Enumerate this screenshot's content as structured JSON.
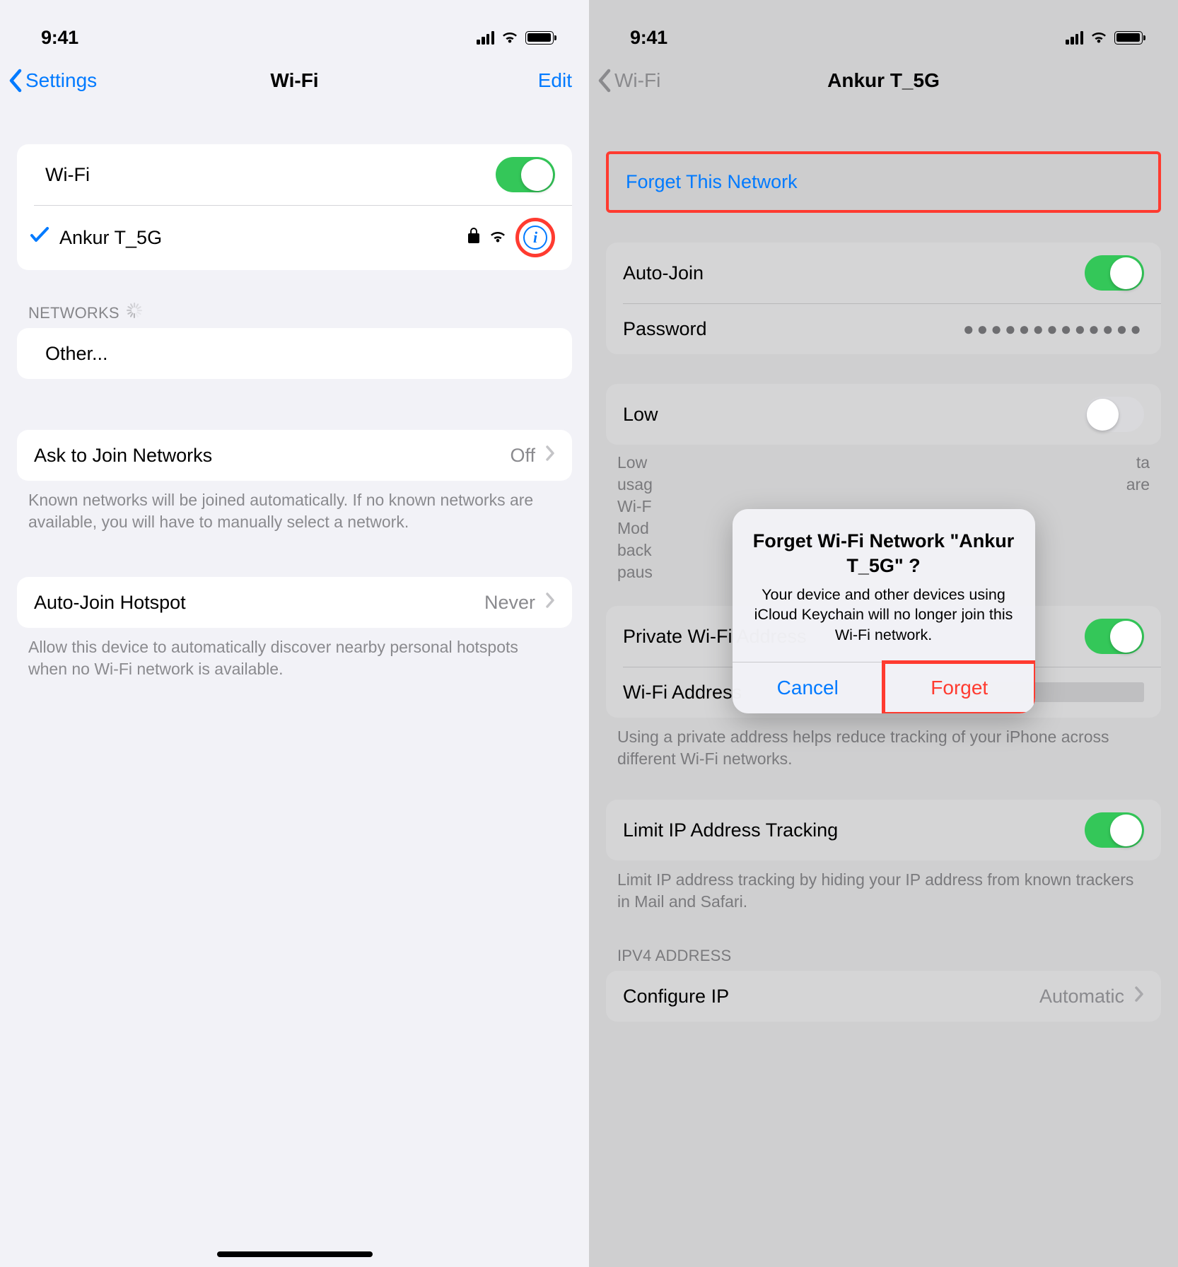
{
  "statusbar": {
    "time": "9:41"
  },
  "left": {
    "nav": {
      "back": "Settings",
      "title": "Wi-Fi",
      "edit": "Edit"
    },
    "wifi_row_label": "Wi-Fi",
    "connected_network": "Ankur T_5G",
    "networks_header": "NETWORKS",
    "other_label": "Other...",
    "ask_join": {
      "label": "Ask to Join Networks",
      "value": "Off"
    },
    "ask_join_footer": "Known networks will be joined automatically. If no known networks are available, you will have to manually select a network.",
    "auto_hotspot": {
      "label": "Auto-Join Hotspot",
      "value": "Never"
    },
    "auto_hotspot_footer": "Allow this device to automatically discover nearby personal hotspots when no Wi-Fi network is available."
  },
  "right": {
    "nav": {
      "back": "Wi-Fi",
      "title": "Ankur T_5G"
    },
    "forget_label": "Forget This Network",
    "auto_join_label": "Auto-Join",
    "password_label": "Password",
    "password_mask": "●●●●●●●●●●●●●",
    "low_data_label": "Low",
    "low_data_footer_lines": [
      "Low",
      "usag",
      "Wi-F",
      "Mod",
      "back",
      "paus"
    ],
    "low_data_footer_right": [
      "ta",
      "",
      "",
      "",
      "are",
      ""
    ],
    "private_addr_label": "Private Wi-Fi Address",
    "wifi_addr_label": "Wi-Fi Address",
    "private_footer": "Using a private address helps reduce tracking of your iPhone across different Wi-Fi networks.",
    "limit_ip_label": "Limit IP Address Tracking",
    "limit_ip_footer": "Limit IP address tracking by hiding your IP address from known trackers in Mail and Safari.",
    "ipv4_header": "IPV4 ADDRESS",
    "configure_ip": {
      "label": "Configure IP",
      "value": "Automatic"
    },
    "alert": {
      "title": "Forget Wi-Fi Network \"Ankur T_5G\" ?",
      "message": "Your device and other devices using iCloud Keychain will no longer join this Wi-Fi network.",
      "cancel": "Cancel",
      "confirm": "Forget"
    }
  }
}
